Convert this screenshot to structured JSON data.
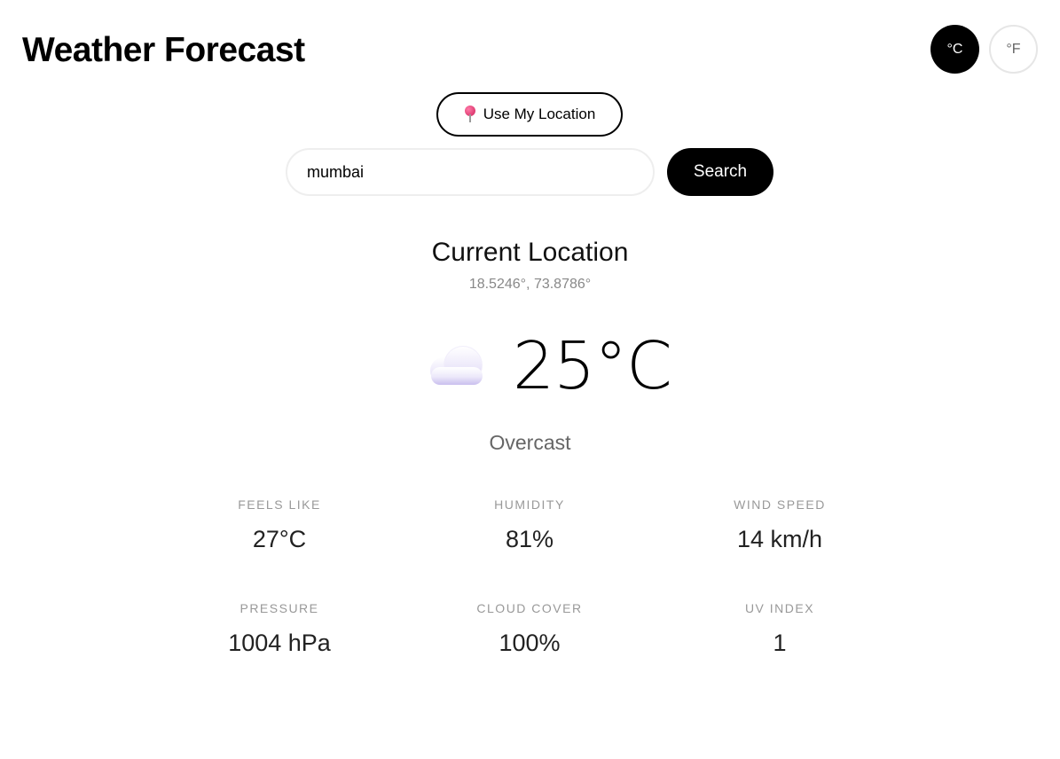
{
  "header": {
    "title": "Weather Forecast",
    "units": [
      "°C",
      "°F"
    ],
    "active_unit": "°C"
  },
  "location_button": {
    "label": "Use My Location",
    "icon": "pushpin-icon"
  },
  "search": {
    "value": "mumbai",
    "button_label": "Search"
  },
  "current": {
    "location_name": "Current Location",
    "coordinates": "18.5246°, 73.8786°",
    "temperature": "25°C",
    "condition": "Overcast",
    "icon": "cloud-icon"
  },
  "stats": [
    {
      "label": "FEELS LIKE",
      "value": "27°C"
    },
    {
      "label": "HUMIDITY",
      "value": "81%"
    },
    {
      "label": "WIND SPEED",
      "value": "14 km/h"
    },
    {
      "label": "PRESSURE",
      "value": "1004 hPa"
    },
    {
      "label": "CLOUD COVER",
      "value": "100%"
    },
    {
      "label": "UV INDEX",
      "value": "1"
    }
  ],
  "colors": {
    "primary": "#000000",
    "background": "#ffffff",
    "muted_text": "#999999",
    "pin": "#d0215a",
    "cloud": "#dcd6f2"
  }
}
